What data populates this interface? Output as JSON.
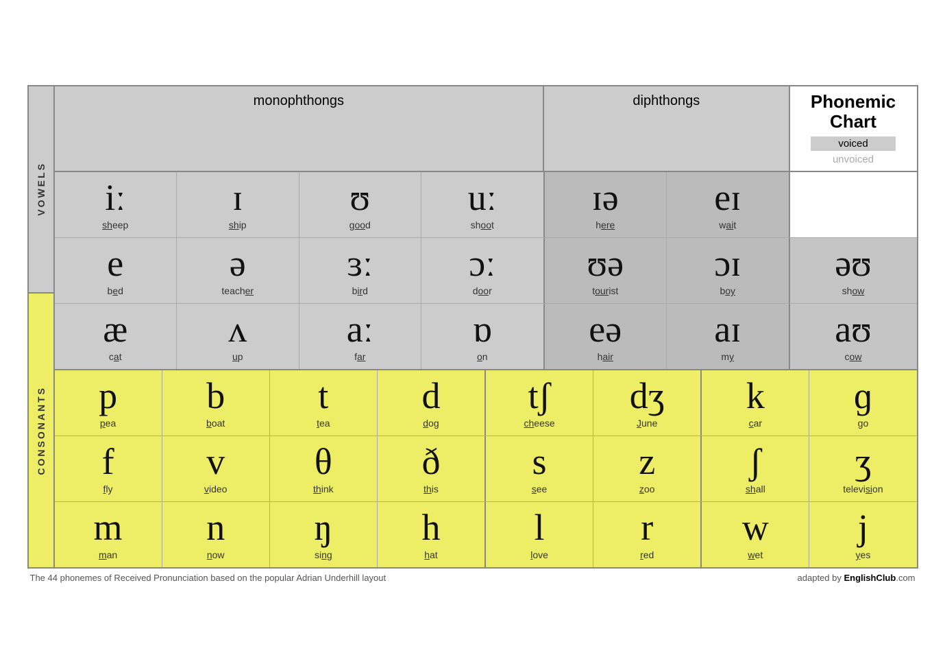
{
  "title": {
    "line1": "Phonemic",
    "line2": "Chart",
    "voiced": "voiced",
    "unvoiced": "unvoiced"
  },
  "headers": {
    "monophthongs": "monophthongs",
    "diphthongs": "diphthongs"
  },
  "labels": {
    "vowels": "VOWELS",
    "consonants": "CONSONANTS"
  },
  "vowel_rows": [
    {
      "cells": [
        {
          "symbol": "iː",
          "word": "sheep",
          "ul": "sh"
        },
        {
          "symbol": "ɪ",
          "word": "ship",
          "ul": "sh"
        },
        {
          "symbol": "ʊ",
          "word": "good",
          "ul": "oo"
        },
        {
          "symbol": "uː",
          "word": "shoot",
          "ul": "oo"
        },
        {
          "symbol": "ɪə",
          "word": "here",
          "ul": "ere"
        },
        {
          "symbol": "eɪ",
          "word": "wait",
          "ul": "ai"
        },
        {
          "symbol": "",
          "word": "",
          "ul": ""
        }
      ]
    },
    {
      "cells": [
        {
          "symbol": "e",
          "word": "bed",
          "ul": "e"
        },
        {
          "symbol": "ə",
          "word": "teacher",
          "ul": "er"
        },
        {
          "symbol": "ɜː",
          "word": "bird",
          "ul": "ir"
        },
        {
          "symbol": "ɔː",
          "word": "door",
          "ul": "oor"
        },
        {
          "symbol": "ʊə",
          "word": "tourist",
          "ul": "our"
        },
        {
          "symbol": "ɔɪ",
          "word": "boy",
          "ul": "oy"
        },
        {
          "symbol": "əʊ",
          "word": "show",
          "ul": "ow"
        }
      ]
    },
    {
      "cells": [
        {
          "symbol": "æ",
          "word": "cat",
          "ul": "a"
        },
        {
          "symbol": "ʌ",
          "word": "up",
          "ul": "u"
        },
        {
          "symbol": "aː",
          "word": "far",
          "ul": "ar"
        },
        {
          "symbol": "ɒ",
          "word": "on",
          "ul": "o"
        },
        {
          "symbol": "eə",
          "word": "hair",
          "ul": "air"
        },
        {
          "symbol": "aɪ",
          "word": "my",
          "ul": "y"
        },
        {
          "symbol": "aʊ",
          "word": "cow",
          "ul": "ow"
        }
      ]
    }
  ],
  "consonant_rows": [
    {
      "cells": [
        {
          "symbol": "p",
          "word": "pea",
          "ul": "p"
        },
        {
          "symbol": "b",
          "word": "boat",
          "ul": "b"
        },
        {
          "symbol": "t",
          "word": "tea",
          "ul": "t"
        },
        {
          "symbol": "d",
          "word": "dog",
          "ul": "d"
        },
        {
          "symbol": "tʃ",
          "word": "cheese",
          "ul": "ch"
        },
        {
          "symbol": "dʒ",
          "word": "June",
          "ul": "J"
        },
        {
          "symbol": "k",
          "word": "car",
          "ul": "c"
        },
        {
          "symbol": "ɡ",
          "word": "go",
          "ul": "g"
        }
      ]
    },
    {
      "cells": [
        {
          "symbol": "f",
          "word": "fly",
          "ul": "f"
        },
        {
          "symbol": "v",
          "word": "video",
          "ul": "v"
        },
        {
          "symbol": "θ",
          "word": "think",
          "ul": "th"
        },
        {
          "symbol": "ð",
          "word": "this",
          "ul": "th"
        },
        {
          "symbol": "s",
          "word": "see",
          "ul": "s"
        },
        {
          "symbol": "z",
          "word": "zoo",
          "ul": "z"
        },
        {
          "symbol": "ʃ",
          "word": "shall",
          "ul": "sh"
        },
        {
          "symbol": "ʒ",
          "word": "television",
          "ul": "si"
        }
      ]
    },
    {
      "cells": [
        {
          "symbol": "m",
          "word": "man",
          "ul": "m"
        },
        {
          "symbol": "n",
          "word": "now",
          "ul": "n"
        },
        {
          "symbol": "ŋ",
          "word": "sing",
          "ul": "ng"
        },
        {
          "symbol": "h",
          "word": "hat",
          "ul": "h"
        },
        {
          "symbol": "l",
          "word": "love",
          "ul": "l"
        },
        {
          "symbol": "r",
          "word": "red",
          "ul": "r"
        },
        {
          "symbol": "w",
          "word": "wet",
          "ul": "w"
        },
        {
          "symbol": "j",
          "word": "yes",
          "ul": "y"
        }
      ]
    }
  ],
  "footer": {
    "left": "The 44 phonemes of Received Pronunciation based on the popular Adrian Underhill layout",
    "right_prefix": "adapted by ",
    "right_brand": "EnglishClub",
    "right_suffix": ".com"
  }
}
